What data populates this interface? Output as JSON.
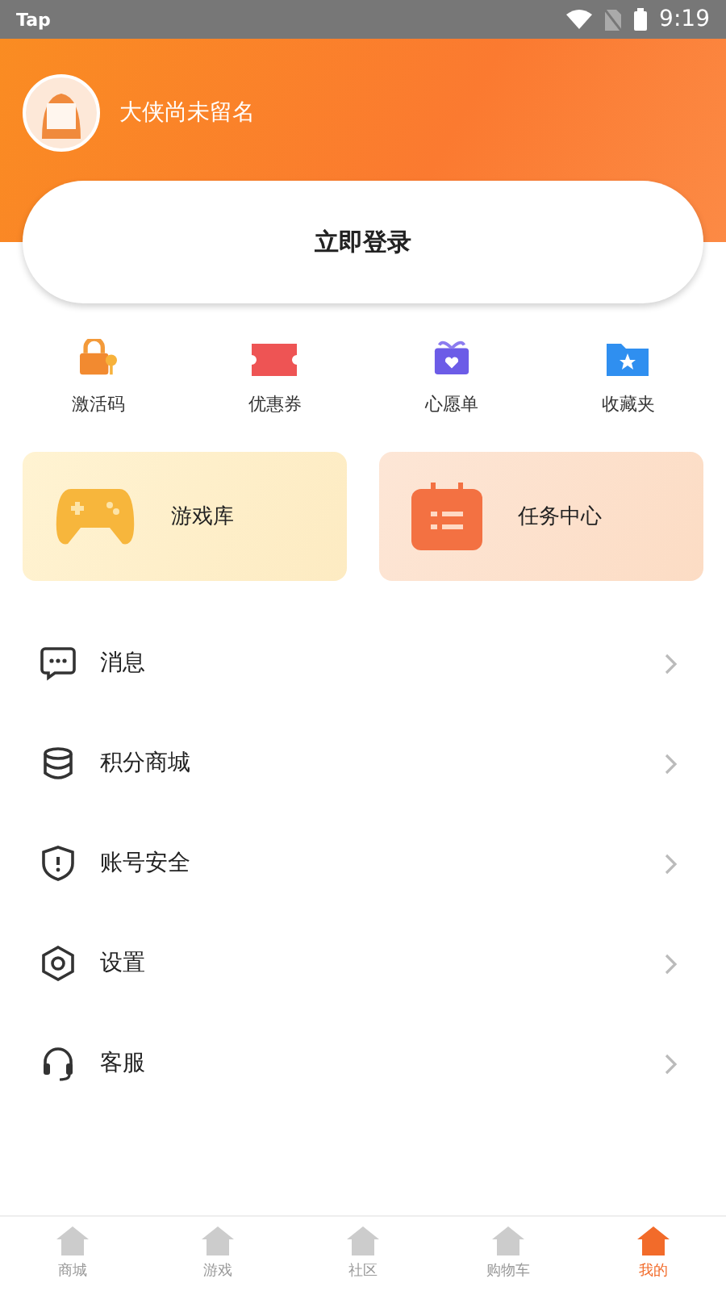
{
  "status_bar": {
    "app": "Tap",
    "time": "9:19"
  },
  "profile": {
    "name": "大侠尚未留名"
  },
  "login_button": "立即登录",
  "shortcuts": [
    {
      "label": "激活码",
      "kind": "lock"
    },
    {
      "label": "优惠券",
      "kind": "ticket"
    },
    {
      "label": "心愿单",
      "kind": "gift"
    },
    {
      "label": "收藏夹",
      "kind": "folder"
    }
  ],
  "cards": [
    {
      "label": "游戏库",
      "kind": "gamepad"
    },
    {
      "label": "任务中心",
      "kind": "calendar"
    }
  ],
  "menu": [
    {
      "label": "消息",
      "kind": "message"
    },
    {
      "label": "积分商城",
      "kind": "coins"
    },
    {
      "label": "账号安全",
      "kind": "shield"
    },
    {
      "label": "设置",
      "kind": "settings"
    },
    {
      "label": "客服",
      "kind": "headset"
    }
  ],
  "bottom_nav": [
    {
      "label": "商城",
      "selected": false
    },
    {
      "label": "游戏",
      "selected": false
    },
    {
      "label": "社区",
      "selected": false
    },
    {
      "label": "购物车",
      "selected": false
    },
    {
      "label": "我的",
      "selected": true
    }
  ]
}
